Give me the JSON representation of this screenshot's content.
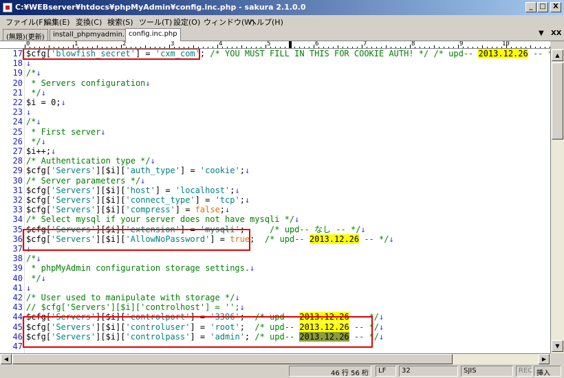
{
  "window": {
    "title": "C:¥WEBserver¥htdocs¥phpMyAdmin¥config.inc.php - sakura 2.1.0.0",
    "btn_min": "_",
    "btn_max": "□",
    "btn_close": "X"
  },
  "menu": [
    "ファイル(F)",
    "編集(E)",
    "変換(C)",
    "検索(S)",
    "ツール(T)",
    "設定(O)",
    "ウィンドウ(W)",
    "ヘルプ(H)"
  ],
  "tabs": [
    "(無題)(更新)",
    "install_phpmyadmin.php",
    "config.inc.php"
  ],
  "tab_controls": {
    "down": "▼",
    "close": "XX"
  },
  "ruler": {
    "labels": [
      "0",
      "1",
      "2",
      "3",
      "4",
      "5",
      "6",
      "7",
      "8",
      "9",
      "10"
    ]
  },
  "editor": {
    "eol": "↓",
    "lines": [
      {
        "n": "17",
        "segs": [
          {
            "t": "$cfg[",
            "c": "var"
          },
          {
            "t": "'blowfish_secret'",
            "c": "str"
          },
          {
            "t": "] = ",
            "c": "var"
          },
          {
            "t": "'cxm_com'",
            "c": "str"
          },
          {
            "t": ";",
            "c": "var"
          },
          {
            "t": " /* YOU MUST FILL IN THIS FOR COOKIE AUTH! */ /* upd-- ",
            "c": "cmt"
          },
          {
            "t": "2013.12.26",
            "c": "hl"
          },
          {
            "t": " -- */",
            "c": "cmt"
          }
        ]
      },
      {
        "n": "18",
        "segs": []
      },
      {
        "n": "19",
        "segs": [
          {
            "t": "/*",
            "c": "cmt"
          }
        ]
      },
      {
        "n": "20",
        "segs": [
          {
            "t": " * Servers configuration",
            "c": "cmt"
          }
        ]
      },
      {
        "n": "21",
        "segs": [
          {
            "t": " */",
            "c": "cmt"
          }
        ]
      },
      {
        "n": "22",
        "segs": [
          {
            "t": "$i = 0;",
            "c": "var"
          }
        ]
      },
      {
        "n": "23",
        "segs": []
      },
      {
        "n": "24",
        "segs": [
          {
            "t": "/*",
            "c": "cmt"
          }
        ]
      },
      {
        "n": "25",
        "segs": [
          {
            "t": " * First server",
            "c": "cmt"
          }
        ]
      },
      {
        "n": "26",
        "segs": [
          {
            "t": " */",
            "c": "cmt"
          }
        ]
      },
      {
        "n": "27",
        "segs": [
          {
            "t": "$i++;",
            "c": "var"
          }
        ]
      },
      {
        "n": "28",
        "segs": [
          {
            "t": "/* Authentication type */",
            "c": "cmt"
          }
        ]
      },
      {
        "n": "29",
        "segs": [
          {
            "t": "$cfg[",
            "c": "var"
          },
          {
            "t": "'Servers'",
            "c": "str"
          },
          {
            "t": "][$i][",
            "c": "var"
          },
          {
            "t": "'auth_type'",
            "c": "str"
          },
          {
            "t": "] = ",
            "c": "var"
          },
          {
            "t": "'cookie'",
            "c": "str"
          },
          {
            "t": ";",
            "c": "var"
          }
        ]
      },
      {
        "n": "30",
        "segs": [
          {
            "t": "/* Server parameters */",
            "c": "cmt"
          }
        ]
      },
      {
        "n": "31",
        "segs": [
          {
            "t": "$cfg[",
            "c": "var"
          },
          {
            "t": "'Servers'",
            "c": "str"
          },
          {
            "t": "][$i][",
            "c": "var"
          },
          {
            "t": "'host'",
            "c": "str"
          },
          {
            "t": "] = ",
            "c": "var"
          },
          {
            "t": "'localhost'",
            "c": "str"
          },
          {
            "t": ";",
            "c": "var"
          }
        ]
      },
      {
        "n": "32",
        "segs": [
          {
            "t": "$cfg[",
            "c": "var"
          },
          {
            "t": "'Servers'",
            "c": "str"
          },
          {
            "t": "][$i][",
            "c": "var"
          },
          {
            "t": "'connect_type'",
            "c": "str"
          },
          {
            "t": "] = ",
            "c": "var"
          },
          {
            "t": "'tcp'",
            "c": "str"
          },
          {
            "t": ";",
            "c": "var"
          }
        ]
      },
      {
        "n": "33",
        "segs": [
          {
            "t": "$cfg[",
            "c": "var"
          },
          {
            "t": "'Servers'",
            "c": "str"
          },
          {
            "t": "][$i][",
            "c": "var"
          },
          {
            "t": "'compress'",
            "c": "str"
          },
          {
            "t": "] = ",
            "c": "var"
          },
          {
            "t": "false",
            "c": "kw"
          },
          {
            "t": ";",
            "c": "var"
          }
        ]
      },
      {
        "n": "34",
        "segs": [
          {
            "t": "/* Select mysql if your server does not have mysqli */",
            "c": "cmt"
          }
        ]
      },
      {
        "n": "35",
        "segs": [
          {
            "t": "$cfg[",
            "c": "var"
          },
          {
            "t": "'Servers'",
            "c": "str"
          },
          {
            "t": "][$i][",
            "c": "var"
          },
          {
            "t": "'extension'",
            "c": "str"
          },
          {
            "t": "] = ",
            "c": "var"
          },
          {
            "t": "'mysqli'",
            "c": "str"
          },
          {
            "t": ";",
            "c": "var"
          },
          {
            "t": "     /* upd-- なし -- */",
            "c": "cmt"
          }
        ]
      },
      {
        "n": "36",
        "segs": [
          {
            "t": "$cfg[",
            "c": "var"
          },
          {
            "t": "'Servers'",
            "c": "str"
          },
          {
            "t": "][$i][",
            "c": "var"
          },
          {
            "t": "'AllowNoPassword'",
            "c": "str"
          },
          {
            "t": "] = ",
            "c": "var"
          },
          {
            "t": "true",
            "c": "kw"
          },
          {
            "t": ";",
            "c": "var"
          },
          {
            "t": "  /* upd-- ",
            "c": "cmt"
          },
          {
            "t": "2013.12.26",
            "c": "hl"
          },
          {
            "t": " -- */",
            "c": "cmt"
          }
        ]
      },
      {
        "n": "37",
        "segs": []
      },
      {
        "n": "38",
        "segs": [
          {
            "t": "/*",
            "c": "cmt"
          }
        ]
      },
      {
        "n": "39",
        "segs": [
          {
            "t": " * phpMyAdmin configuration storage settings.",
            "c": "cmt"
          }
        ]
      },
      {
        "n": "40",
        "segs": [
          {
            "t": " */",
            "c": "cmt"
          }
        ]
      },
      {
        "n": "41",
        "segs": []
      },
      {
        "n": "42",
        "segs": [
          {
            "t": "/* User used to manipulate with storage */",
            "c": "cmt"
          }
        ]
      },
      {
        "n": "43",
        "segs": [
          {
            "t": "// $cfg['Servers'][$i]['controlhost'] = '';",
            "c": "cmt"
          }
        ]
      },
      {
        "n": "44",
        "segs": [
          {
            "t": "$cfg[",
            "c": "var"
          },
          {
            "t": "'Servers'",
            "c": "str"
          },
          {
            "t": "][$i][",
            "c": "var"
          },
          {
            "t": "'controlport'",
            "c": "str"
          },
          {
            "t": "] = ",
            "c": "var"
          },
          {
            "t": "'3306'",
            "c": "str"
          },
          {
            "t": ";",
            "c": "var"
          },
          {
            "t": "  /* upd-- ",
            "c": "cmt"
          },
          {
            "t": "2013.12.26",
            "c": "hl"
          },
          {
            "t": " -- */",
            "c": "cmt"
          }
        ]
      },
      {
        "n": "45",
        "segs": [
          {
            "t": "$cfg[",
            "c": "var"
          },
          {
            "t": "'Servers'",
            "c": "str"
          },
          {
            "t": "][$i][",
            "c": "var"
          },
          {
            "t": "'controluser'",
            "c": "str"
          },
          {
            "t": "] = ",
            "c": "var"
          },
          {
            "t": "'root'",
            "c": "str"
          },
          {
            "t": ";",
            "c": "var"
          },
          {
            "t": "  /* upd-- ",
            "c": "cmt"
          },
          {
            "t": "2013.12.26",
            "c": "hl"
          },
          {
            "t": " -- */",
            "c": "cmt"
          }
        ]
      },
      {
        "n": "46",
        "segs": [
          {
            "t": "$cfg[",
            "c": "var"
          },
          {
            "t": "'Servers'",
            "c": "str"
          },
          {
            "t": "][$i][",
            "c": "var"
          },
          {
            "t": "'controlpass'",
            "c": "str"
          },
          {
            "t": "] = ",
            "c": "var"
          },
          {
            "t": "'admin'",
            "c": "str"
          },
          {
            "t": ";",
            "c": "var"
          },
          {
            "t": " /* upd-- ",
            "c": "cmt"
          },
          {
            "t": "2013.12.26",
            "c": "hlsel"
          },
          {
            "t": " -- */",
            "c": "cmt"
          }
        ]
      },
      {
        "n": "47",
        "segs": []
      }
    ]
  },
  "status": {
    "position": "46 行  56 桁",
    "line_ending": "LF",
    "char_code": "32",
    "encoding": "SJIS",
    "rec": "REC",
    "mode": "挿入"
  },
  "scroll": {
    "up": "▲",
    "down": "▼",
    "left": "◀",
    "right": "▶"
  },
  "colors": {
    "highlight": "#ffff00",
    "highlight_selected": "#8c9c3c",
    "annotation_box": "#e00000",
    "string": "#008080",
    "comment": "#008000",
    "keyword": "#e07000",
    "line_number": "#2020c0"
  }
}
